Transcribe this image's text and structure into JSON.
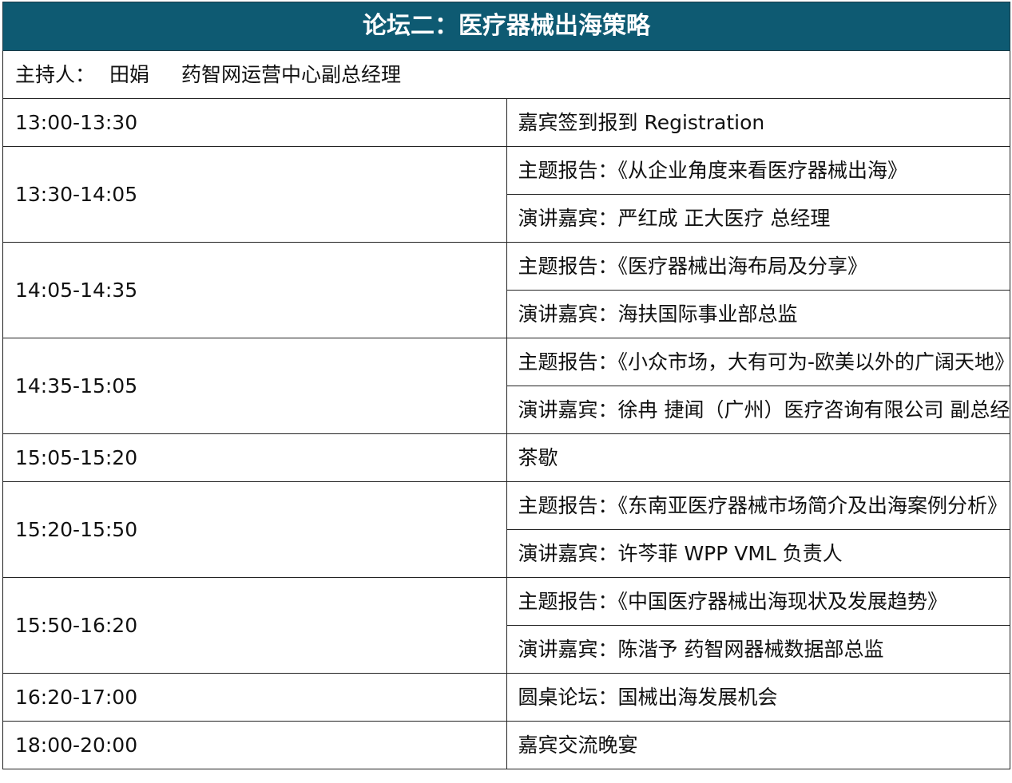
{
  "title": "论坛二：医疗器械出海策略",
  "host": {
    "label": "主持人：",
    "name": "田娟",
    "position": "药智网运营中心副总经理"
  },
  "schedule": [
    {
      "time": "13:00-13:30",
      "items": [
        "嘉宾签到报到 Registration"
      ]
    },
    {
      "time": "13:30-14:05",
      "items": [
        "主题报告：《从企业角度来看医疗器械出海》",
        "演讲嘉宾：严红成  正大医疗  总经理"
      ]
    },
    {
      "time": "14:05-14:35",
      "items": [
        "主题报告：《医疗器械出海布局及分享》",
        "演讲嘉宾：海扶国际事业部总监"
      ]
    },
    {
      "time": "14:35-15:05",
      "items": [
        "主题报告：《小众市场，大有可为-欧美以外的广阔天地》",
        "演讲嘉宾：徐冉  捷闻（广州）医疗咨询有限公司  副总经理"
      ]
    },
    {
      "time": "15:05-15:20",
      "items": [
        "茶歇"
      ]
    },
    {
      "time": "15:20-15:50",
      "items": [
        "主题报告：《东南亚医疗器械市场简介及出海案例分析》",
        "演讲嘉宾：许芩菲  WPP VML  负责人"
      ]
    },
    {
      "time": "15:50-16:20",
      "items": [
        "主题报告：《中国医疗器械出海现状及发展趋势》",
        "演讲嘉宾：陈湝予  药智网器械数据部总监"
      ]
    },
    {
      "time": "16:20-17:00",
      "items": [
        "圆桌论坛：国械出海发展机会"
      ]
    },
    {
      "time": "18:00-20:00",
      "items": [
        "嘉宾交流晚宴"
      ]
    }
  ]
}
